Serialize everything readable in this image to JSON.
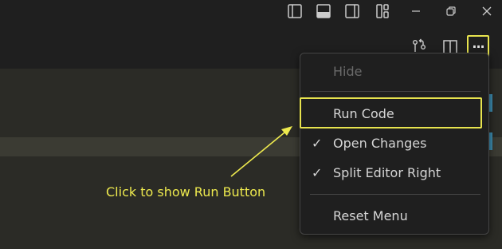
{
  "titlebar": {
    "icons": [
      "toggle-primary-sidebar-icon",
      "toggle-panel-icon",
      "toggle-secondary-sidebar-icon",
      "customize-layout-icon",
      "minimize-icon",
      "restore-icon",
      "close-icon"
    ]
  },
  "editor_actions": {
    "icons": [
      "open-changes-icon",
      "split-editor-right-icon",
      "more-actions-icon"
    ],
    "more_label": "···"
  },
  "menu": {
    "items": [
      {
        "label": "Hide",
        "enabled": false,
        "checked": false
      },
      {
        "label": "Run Code",
        "enabled": true,
        "checked": false
      },
      {
        "label": "Open Changes",
        "enabled": true,
        "checked": true
      },
      {
        "label": "Split Editor Right",
        "enabled": true,
        "checked": true
      },
      {
        "label": "Reset Menu",
        "enabled": true,
        "checked": false
      }
    ],
    "check_glyph": "✓"
  },
  "annotation": {
    "text": "Click to show Run Button",
    "color": "#eeea4e"
  },
  "colors": {
    "highlight": "#e7e34e",
    "background": "#1f1f1f",
    "editor": "#2b2b26",
    "scroll_marker": "#3d8fb3"
  }
}
